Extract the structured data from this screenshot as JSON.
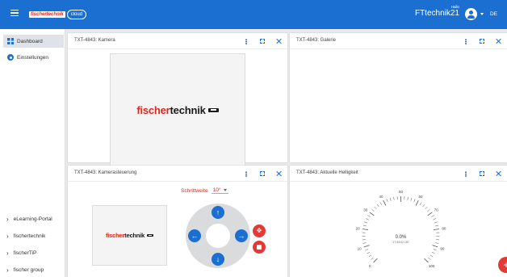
{
  "app": {
    "brand": "fischertechnik",
    "cloud_label": "cloud",
    "greeting": "Hallo",
    "user": "FTtechnik21",
    "language": "DE"
  },
  "sidebar": {
    "items": [
      {
        "label": "Dashboard",
        "icon": "dashboard-icon",
        "active": true
      },
      {
        "label": "Einstellungen",
        "icon": "gear-icon",
        "active": false
      }
    ],
    "links": [
      {
        "label": "eLearning-Portal"
      },
      {
        "label": "fischertechnik"
      },
      {
        "label": "fischerTiP"
      },
      {
        "label": "fischer group"
      }
    ]
  },
  "cards": {
    "camera": {
      "title": "TXT-4843: Kamera",
      "logo_red": "fischer",
      "logo_dark": "technik"
    },
    "gallery": {
      "title": "TXT-4843: Galerie"
    },
    "control": {
      "title": "TXT-4843: Kamerasteuerung",
      "step_label": "Schrittweite",
      "step_value": "10°",
      "logo_red": "fischer",
      "logo_dark": "technik"
    },
    "brightness": {
      "title": "TXT-4843: Aktuelle Helligkeit",
      "value_text": "0.0%",
      "timestamp": "17:34:02 187",
      "ticks": [
        "0",
        "10",
        "20",
        "30",
        "40",
        "50",
        "60",
        "70",
        "80",
        "90",
        "100"
      ]
    }
  },
  "colors": {
    "accent": "#1b6fd1",
    "action_red": "#e53935",
    "brand_red": "#e0231b"
  }
}
